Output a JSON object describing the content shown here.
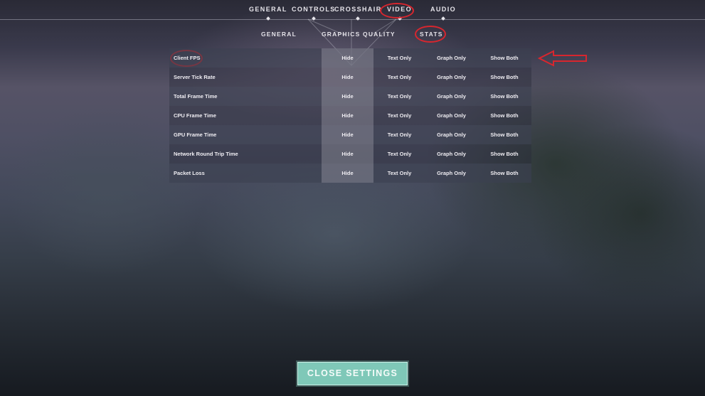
{
  "top_tabs": [
    {
      "label": "GENERAL"
    },
    {
      "label": "CONTROLS"
    },
    {
      "label": "CROSSHAIR"
    },
    {
      "label": "VIDEO"
    },
    {
      "label": "AUDIO"
    }
  ],
  "active_top_tab": "VIDEO",
  "sub_tabs": [
    {
      "label": "GENERAL"
    },
    {
      "label": "GRAPHICS QUALITY"
    },
    {
      "label": "STATS"
    }
  ],
  "active_sub_tab": "STATS",
  "stats": {
    "options": [
      "Hide",
      "Text Only",
      "Graph Only",
      "Show Both"
    ],
    "rows": [
      {
        "name": "Client FPS",
        "options": [
          "Hide",
          "Text Only",
          "Graph Only",
          "Show Both"
        ]
      },
      {
        "name": "Server Tick Rate",
        "options": [
          "Hide",
          "Text Only",
          "Graph Only",
          "Show Both"
        ]
      },
      {
        "name": "Total Frame Time",
        "options": [
          "Hide",
          "Text Only",
          "Graph Only",
          "Show Both"
        ]
      },
      {
        "name": "CPU Frame Time",
        "options": [
          "Hide",
          "Text Only",
          "Graph Only",
          "Show Both"
        ]
      },
      {
        "name": "GPU Frame Time",
        "options": [
          "Hide",
          "Text Only",
          "Graph Only",
          "Show Both"
        ]
      },
      {
        "name": "Network Round Trip Time",
        "options": [
          "Hide",
          "Text Only",
          "Graph Only",
          "Show Both"
        ]
      },
      {
        "name": "Packet Loss",
        "options": [
          "Hide",
          "Text Only",
          "Graph Only",
          "Show Both"
        ]
      }
    ],
    "selected": "Hide"
  },
  "footer": {
    "close_label": "CLOSE SETTINGS"
  },
  "colors": {
    "annotation_red": "#d8262e",
    "close_button": "#7fc8b8"
  }
}
